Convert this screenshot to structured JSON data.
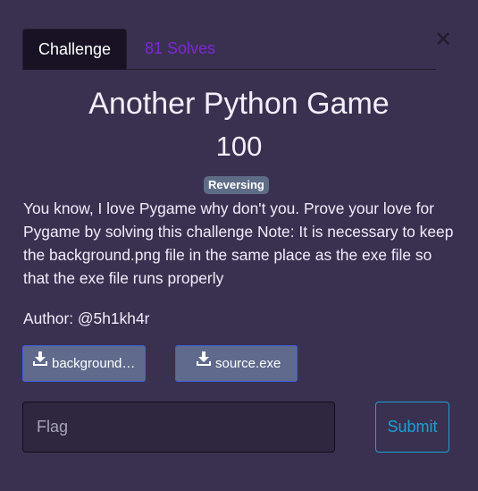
{
  "tabs": {
    "challenge_label": "Challenge",
    "solves_label": "81 Solves"
  },
  "close_icon": "close-icon",
  "challenge": {
    "title": "Another Python Game",
    "points": "100",
    "category_tag": "Reversing",
    "description": "You know, I love Pygame why don't you. Prove your love for Pygame by solving this challenge Note: It is necessary to keep the background.png file in the same place as the exe file so that the exe file runs properly",
    "author": "Author: @5h1kh4r"
  },
  "files": [
    {
      "label": "background.png",
      "icon": "download-icon"
    },
    {
      "label": "source.exe",
      "icon": "download-icon"
    }
  ],
  "form": {
    "flag_placeholder": "Flag",
    "flag_value": "",
    "submit_label": "Submit"
  },
  "colors": {
    "background": "#3a3150",
    "active_tab": "#181224",
    "solves_link": "#7b28d4",
    "tag": "#5e6c86",
    "file_button": "#5f6a8d",
    "submit_accent": "#1ba0d8"
  }
}
